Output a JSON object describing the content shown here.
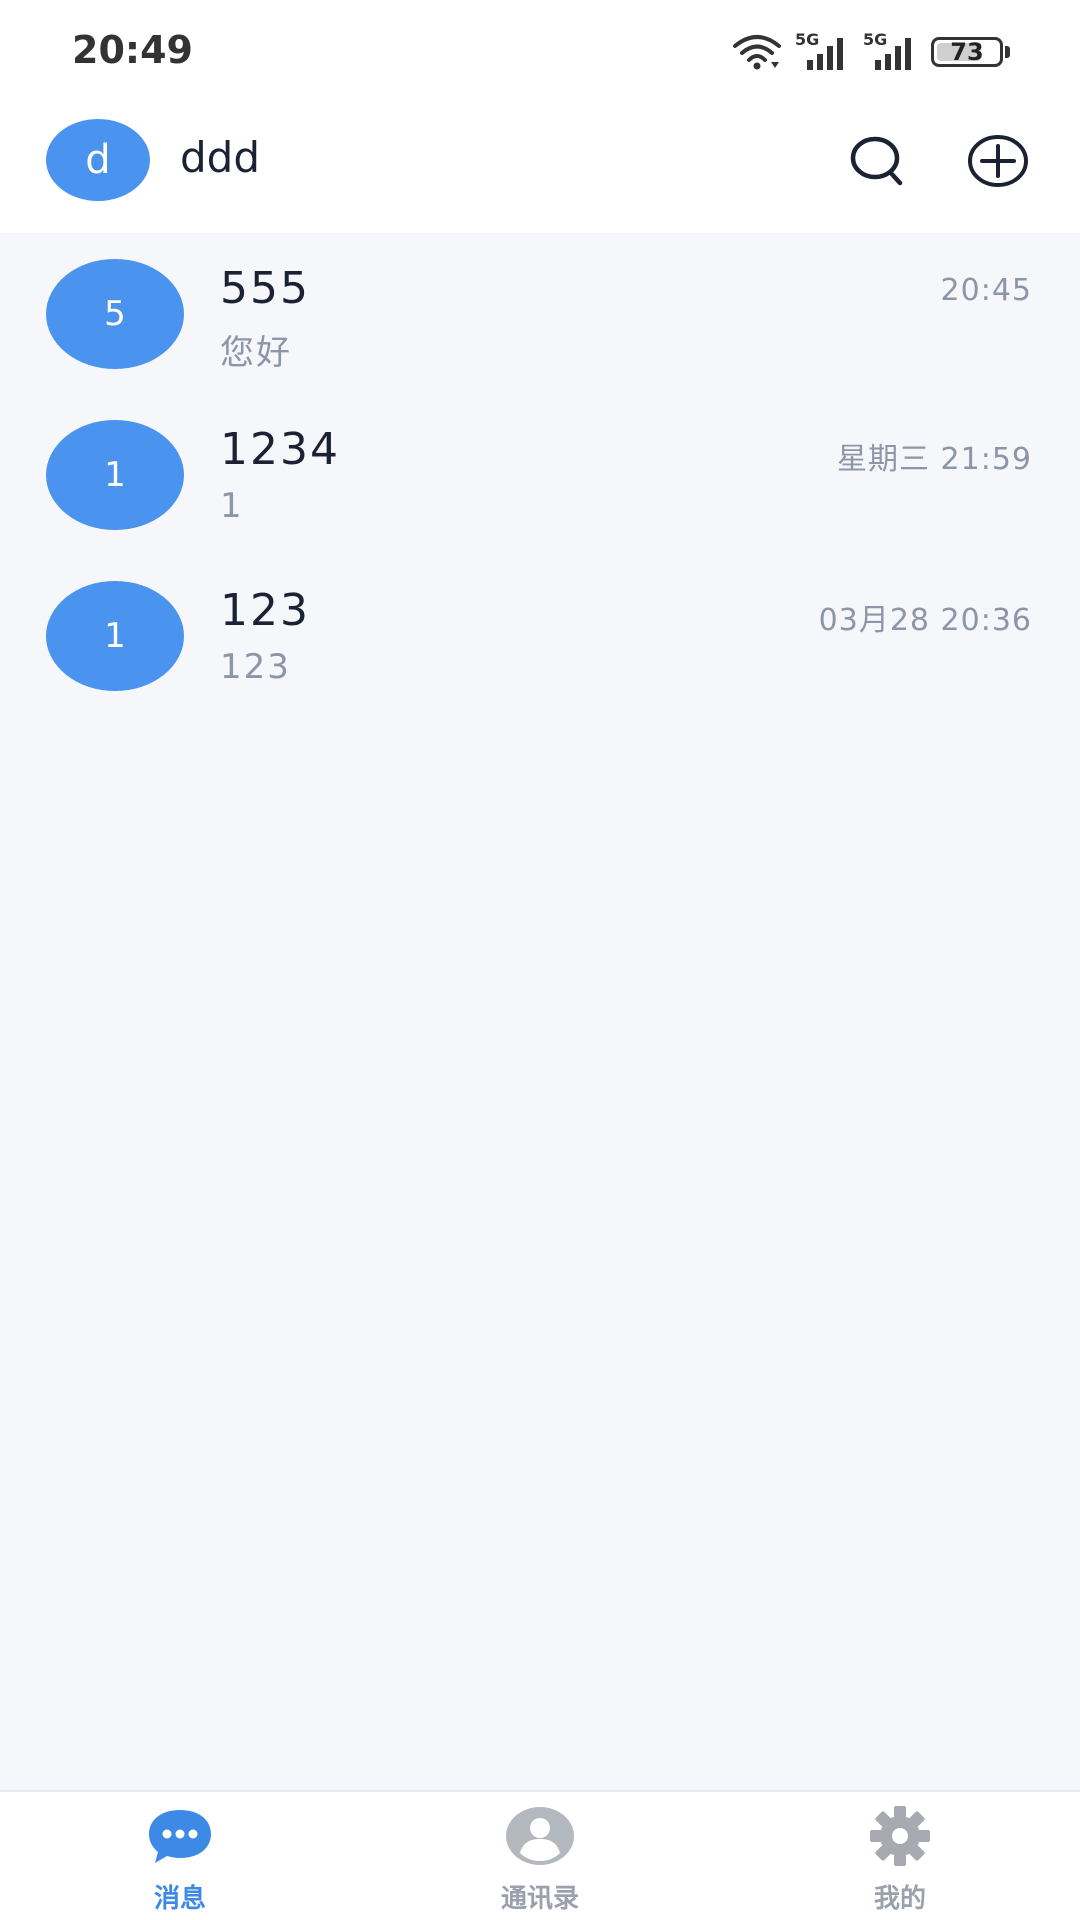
{
  "status_bar": {
    "time": "20:49",
    "network_1": "5G",
    "network_2": "5G",
    "battery_level": "73",
    "battery_fraction": 0.73
  },
  "header": {
    "avatar_initial": "d",
    "username": "ddd",
    "icons": [
      "search-icon",
      "add-circle-icon"
    ]
  },
  "conversations": [
    {
      "avatar_initial": "5",
      "name": "555",
      "preview": "您好",
      "time": "20:45"
    },
    {
      "avatar_initial": "1",
      "name": "1234",
      "preview": "1",
      "time": "星期三 21:59"
    },
    {
      "avatar_initial": "1",
      "name": "123",
      "preview": "123",
      "time": "03月28 20:36"
    }
  ],
  "bottom_nav": [
    {
      "label": "消息",
      "icon": "chat-bubble-icon",
      "active": true
    },
    {
      "label": "通讯录",
      "icon": "contacts-icon",
      "active": false
    },
    {
      "label": "我的",
      "icon": "settings-gear-icon",
      "active": false
    }
  ],
  "colors": {
    "accent": "#4a94ef",
    "active_nav": "#3d8ae6",
    "inactive_nav": "#9aa1ad",
    "background": "#f5f7fa",
    "title_text": "#1b2233",
    "secondary_text": "#8d96a8"
  }
}
